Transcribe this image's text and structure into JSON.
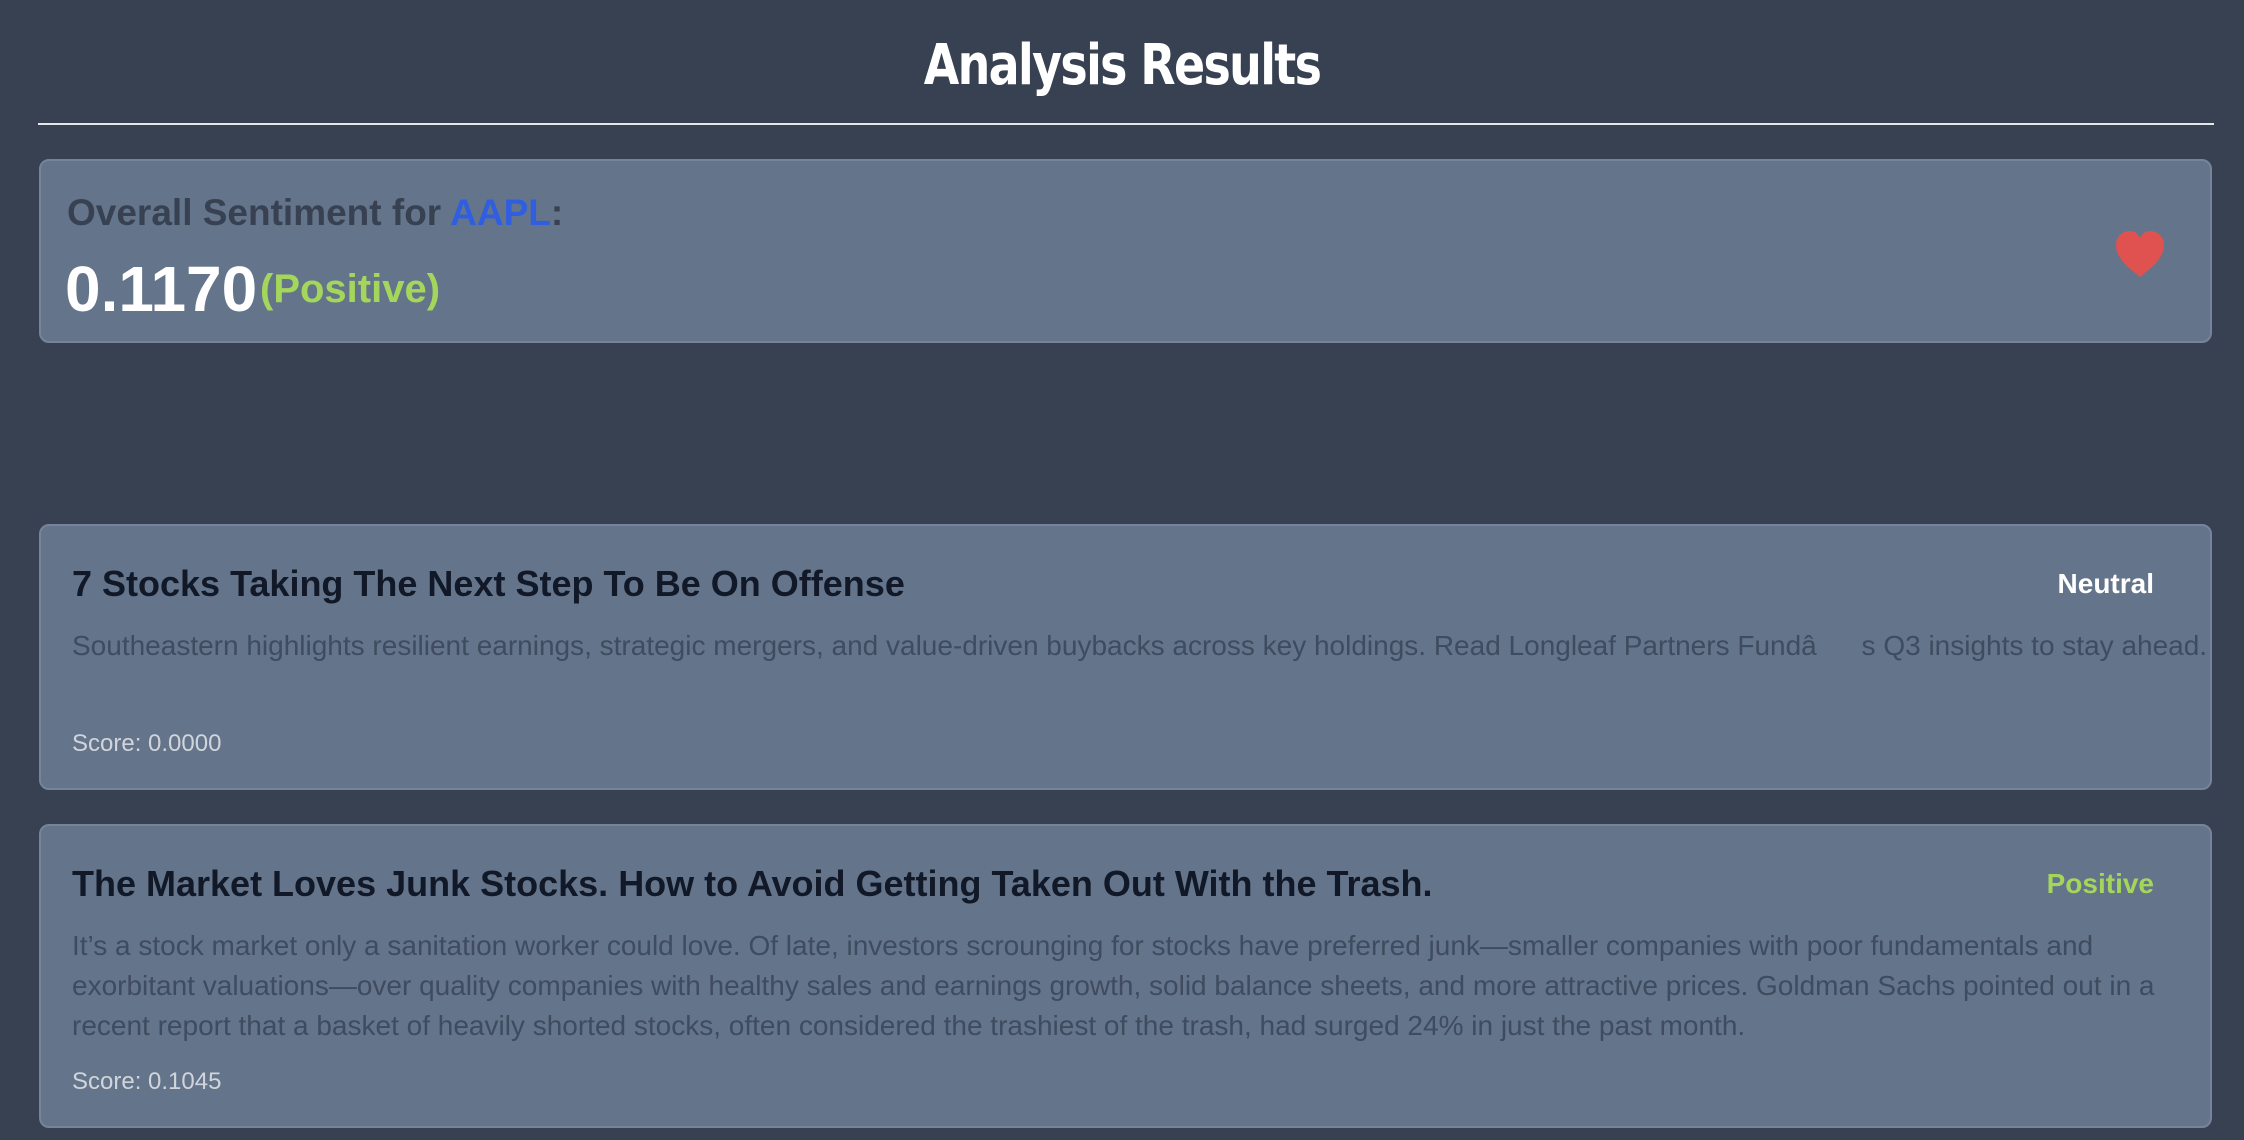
{
  "page": {
    "title": "Analysis Results"
  },
  "summary": {
    "label": "Overall Sentiment for ",
    "ticker": "AAPL",
    "colon": ":",
    "score": "0.1170",
    "sentiment": "(Positive)",
    "icon": "heart-icon",
    "colors": {
      "ticker": "#2f5fe0",
      "positive": "#a3d65b",
      "heart": "#e0524f"
    }
  },
  "articles": [
    {
      "title": "7 Stocks Taking The Next Step To Be On Offense",
      "badge": "Neutral",
      "badge_color": "#ffffff",
      "body": "Southeastern highlights resilient earnings, strategic mergers, and value-driven buybacks across key holdings. Read Longleaf Partners Fundâs Q3 insights to stay ahead.",
      "score": "Score: 0.0000"
    },
    {
      "title": "The Market Loves Junk Stocks. How to Avoid Getting Taken Out With the Trash.",
      "badge": "Positive",
      "badge_color": "#a3d65b",
      "body": "It’s a stock market only a sanitation worker could love. Of late, investors scrounging for stocks have preferred junk—smaller companies with poor fundamentals and exorbitant valuations—over quality companies with healthy sales and earnings growth, solid balance sheets, and more attractive prices. Goldman Sachs pointed out in a recent report that a basket of heavily shorted stocks, often considered the trashiest of the trash, had surged 24% in just the past month.",
      "score": "Score: 0.1045"
    }
  ]
}
